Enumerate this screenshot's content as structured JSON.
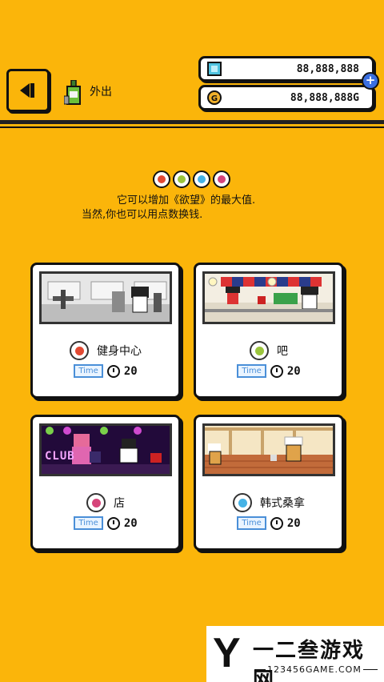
{
  "header": {
    "go_out_label": "外出",
    "gems": "88,888,888",
    "coins": "88,888,888G",
    "plus_label": "+"
  },
  "description": {
    "line1": "它可以增加《欲望》的最大值.",
    "line2": "当然,你也可以用点数换钱."
  },
  "cards": [
    {
      "title": "健身中心",
      "time_label": "Time",
      "time_value": "20",
      "icon": "fitness-icon",
      "accent": "#e24a33"
    },
    {
      "title": "吧",
      "time_label": "Time",
      "time_value": "20",
      "icon": "drink-icon",
      "accent": "#9bc53d"
    },
    {
      "title": "店",
      "time_label": "Time",
      "time_value": "20",
      "icon": "music-icon",
      "accent": "#d6457a"
    },
    {
      "title": "韩式桑拿",
      "time_label": "Time",
      "time_value": "20",
      "icon": "sauna-icon",
      "accent": "#46b3e6"
    }
  ],
  "scene_text": {
    "club_sign": "CLUB"
  },
  "watermark": {
    "letter": "Y",
    "title": "一二叁游戏网",
    "site": "123456GAME.COM"
  },
  "colors": {
    "background": "#fbb50a",
    "gem": "#4fc3e0",
    "coin": "#f0b02a",
    "plus": "#3b6fe0",
    "time": "#4a8fd8"
  }
}
